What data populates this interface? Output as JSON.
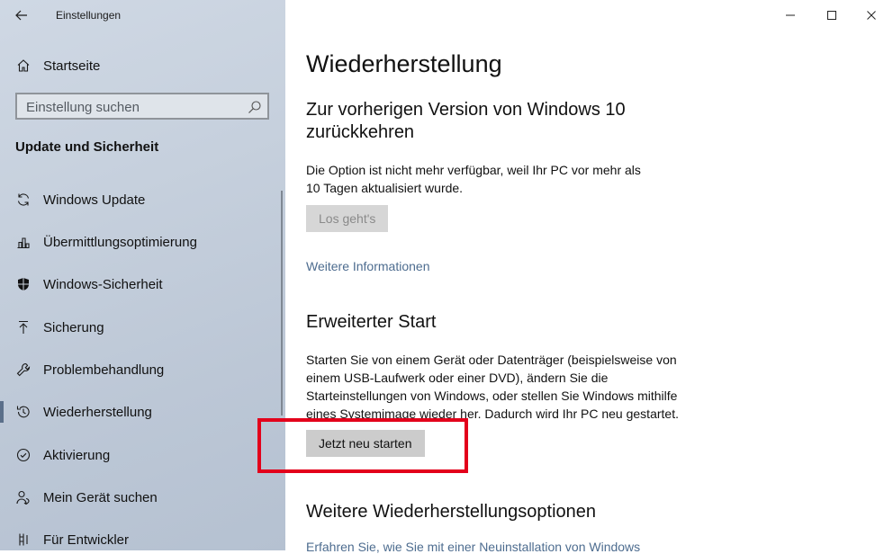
{
  "window": {
    "title": "Einstellungen",
    "controls": [
      "minimize-icon",
      "maximize-icon",
      "close-icon"
    ]
  },
  "sidebar": {
    "home_label": "Startseite",
    "search_placeholder": "Einstellung suchen",
    "section_title": "Update und Sicherheit",
    "items": [
      {
        "label": "Windows Update",
        "icon": "sync-icon"
      },
      {
        "label": "Übermittlungsoptimierung",
        "icon": "delivery-icon"
      },
      {
        "label": "Windows-Sicherheit",
        "icon": "shield-icon"
      },
      {
        "label": "Sicherung",
        "icon": "backup-arrow-icon"
      },
      {
        "label": "Problembehandlung",
        "icon": "wrench-icon"
      },
      {
        "label": "Wiederherstellung",
        "icon": "history-icon",
        "selected": true
      },
      {
        "label": "Aktivierung",
        "icon": "check-circle-icon"
      },
      {
        "label": "Mein Gerät suchen",
        "icon": "person-location-icon"
      },
      {
        "label": "Für Entwickler",
        "icon": "developer-icon"
      }
    ]
  },
  "content": {
    "page_title": "Wiederherstellung",
    "section1": {
      "title_line1": "Zur vorherigen Version von Windows 10",
      "title_line2": "zurückkehren",
      "text_line1": "Die Option ist nicht mehr verfügbar, weil Ihr PC vor mehr als",
      "text_line2": "10 Tagen aktualisiert wurde.",
      "button": "Los geht's",
      "link": "Weitere Informationen"
    },
    "section2": {
      "title": "Erweiterter Start",
      "text_line1": "Starten Sie von einem Gerät oder Datenträger (beispielsweise von",
      "text_line2": "einem USB-Laufwerk oder einer DVD), ändern Sie die",
      "text_line3": "Starteinstellungen von Windows, oder stellen Sie Windows mithilfe",
      "text_line4": "eines Systemimage wieder her. Dadurch wird Ihr PC neu gestartet.",
      "button": "Jetzt neu starten"
    },
    "section3": {
      "title": "Weitere Wiederherstellungsoptionen",
      "cut_text": "Erfahren Sie, wie Sie mit einer Neuinstallation von Windows"
    }
  },
  "colors": {
    "accent_link": "#4d6c8f",
    "highlight_box": "#e3001b"
  }
}
